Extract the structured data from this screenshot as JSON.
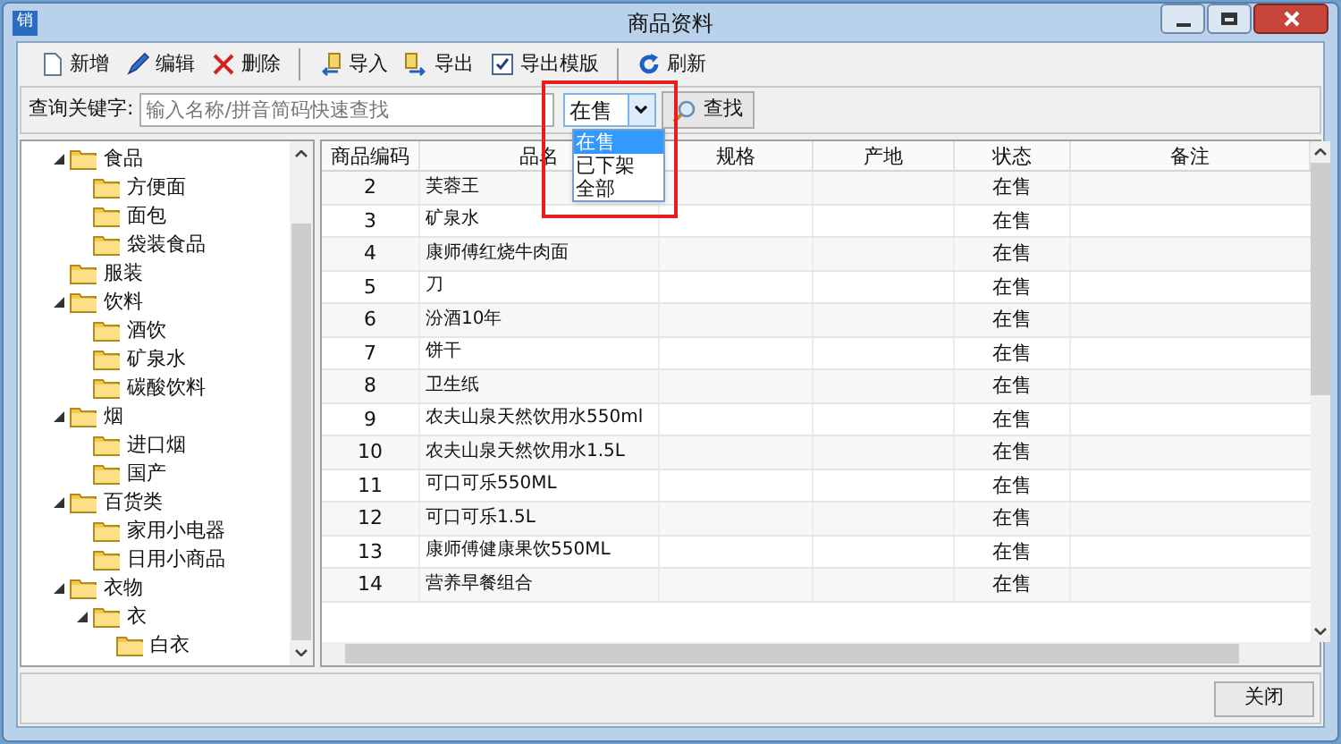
{
  "window": {
    "title": "商品资料",
    "app_icon": "销"
  },
  "toolbar": [
    [
      {
        "label": "新增"
      },
      {
        "label": "编辑"
      },
      {
        "label": "删除"
      }
    ],
    [
      {
        "label": "导入"
      },
      {
        "label": "导出"
      },
      {
        "label": "导出模版"
      }
    ],
    [
      {
        "label": "刷新"
      }
    ]
  ],
  "search": {
    "label": "查询关键字:",
    "placeholder": "输入名称/拼音简码快速查找",
    "status_filter": {
      "value": "在售",
      "expanded": true,
      "options": [
        {
          "label": "在售",
          "selected": true
        },
        {
          "label": "已下架",
          "selected": false
        },
        {
          "label": "全部",
          "selected": false
        }
      ]
    },
    "button": "查找"
  },
  "tree": [
    {
      "label": "食品",
      "expanded": true,
      "children": [
        {
          "label": "方便面"
        },
        {
          "label": "面包"
        },
        {
          "label": "袋装食品"
        }
      ]
    },
    {
      "label": "服装"
    },
    {
      "label": "饮料",
      "expanded": true,
      "children": [
        {
          "label": "酒饮"
        },
        {
          "label": "矿泉水"
        },
        {
          "label": "碳酸饮料"
        }
      ]
    },
    {
      "label": "烟",
      "expanded": true,
      "children": [
        {
          "label": "进口烟"
        },
        {
          "label": "国产"
        }
      ]
    },
    {
      "label": "百货类",
      "expanded": true,
      "children": [
        {
          "label": "家用小电器"
        },
        {
          "label": "日用小商品"
        }
      ]
    },
    {
      "label": "衣物",
      "expanded": true,
      "children": [
        {
          "label": "衣",
          "expanded": true,
          "children": [
            {
              "label": "白衣"
            }
          ]
        }
      ]
    }
  ],
  "table": {
    "columns": [
      "商品编码",
      "品名",
      "规格",
      "产地",
      "状态",
      "备注"
    ],
    "rows": [
      {
        "code": "2",
        "name": "芙蓉王",
        "status": "在售"
      },
      {
        "code": "3",
        "name": "矿泉水",
        "status": "在售"
      },
      {
        "code": "4",
        "name": "康师傅红烧牛肉面",
        "status": "在售"
      },
      {
        "code": "5",
        "name": "刀",
        "status": "在售"
      },
      {
        "code": "6",
        "name": "汾酒10年",
        "status": "在售"
      },
      {
        "code": "7",
        "name": "饼干",
        "status": "在售"
      },
      {
        "code": "8",
        "name": "卫生纸",
        "status": "在售"
      },
      {
        "code": "9",
        "name": "农夫山泉天然饮用水550ml",
        "status": "在售"
      },
      {
        "code": "10",
        "name": "农夫山泉天然饮用水1.5L",
        "status": "在售"
      },
      {
        "code": "11",
        "name": "可口可乐550ML",
        "status": "在售"
      },
      {
        "code": "12",
        "name": "可口可乐1.5L",
        "status": "在售"
      },
      {
        "code": "13",
        "name": "康师傅健康果饮550ML",
        "status": "在售"
      },
      {
        "code": "14",
        "name": "营养早餐组合",
        "status": "在售"
      }
    ]
  },
  "footer": {
    "close_button": "关闭"
  }
}
